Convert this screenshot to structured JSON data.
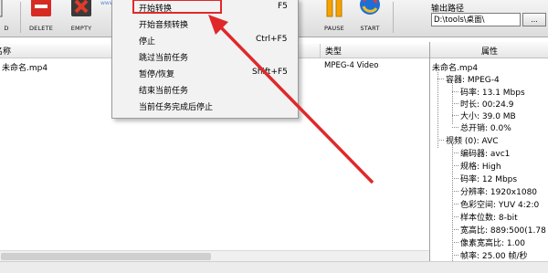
{
  "toolbar": {
    "add_label": "D",
    "delete_label": "DELETE",
    "empty_label": "EMPTY",
    "pause_label": "PAUSE",
    "start_label": "START",
    "watermark": "www.pc0359.cn",
    "output_label": "输出路径",
    "output_path": "D:\\tools\\桌面\\",
    "browse_label": "...",
    "colors": {
      "delete_red": "#e6332a",
      "empty_red": "#d8281f",
      "pause_orange": "#f5a200",
      "start_blue": "#1e6ed8",
      "start_red": "#e04030"
    }
  },
  "file_list": {
    "col_name": "名称",
    "col_type": "类型",
    "rows": [
      {
        "name": "未命名.mp4",
        "type": "MPEG-4 Video"
      }
    ]
  },
  "context_menu": {
    "items": [
      {
        "label": "开始转换",
        "shortcut": "F5",
        "highlighted": true
      },
      {
        "label": "开始音频转换",
        "shortcut": ""
      },
      {
        "label": "停止",
        "shortcut": "Ctrl+F5"
      },
      {
        "label": "跳过当前任务",
        "shortcut": ""
      },
      {
        "label": "暂停/恢复",
        "shortcut": "Shift+F5"
      },
      {
        "label": "结束当前任务",
        "shortcut": ""
      },
      {
        "label": "当前任务完成后停止",
        "shortcut": ""
      }
    ],
    "highlight_color": "#e0282a"
  },
  "properties": {
    "title": "属性",
    "root": "未命名.mp4",
    "container_node": "容器: MPEG-4",
    "container_items": [
      "码率: 13.1 Mbps",
      "时长: 00:24.9",
      "大小: 39.0 MB",
      "总开销: 0.0%"
    ],
    "video_node": "视频 (0): AVC",
    "video_items": [
      "编码器: avc1",
      "规格: High",
      "码率: 12 Mbps",
      "分辨率: 1920x1080",
      "色彩空间: YUV 4:2:0",
      "样本位数: 8-bit",
      "宽高比: 889:500(1.78",
      "像素宽高比: 1.00",
      "帧率: 25.00 帧/秒"
    ]
  }
}
